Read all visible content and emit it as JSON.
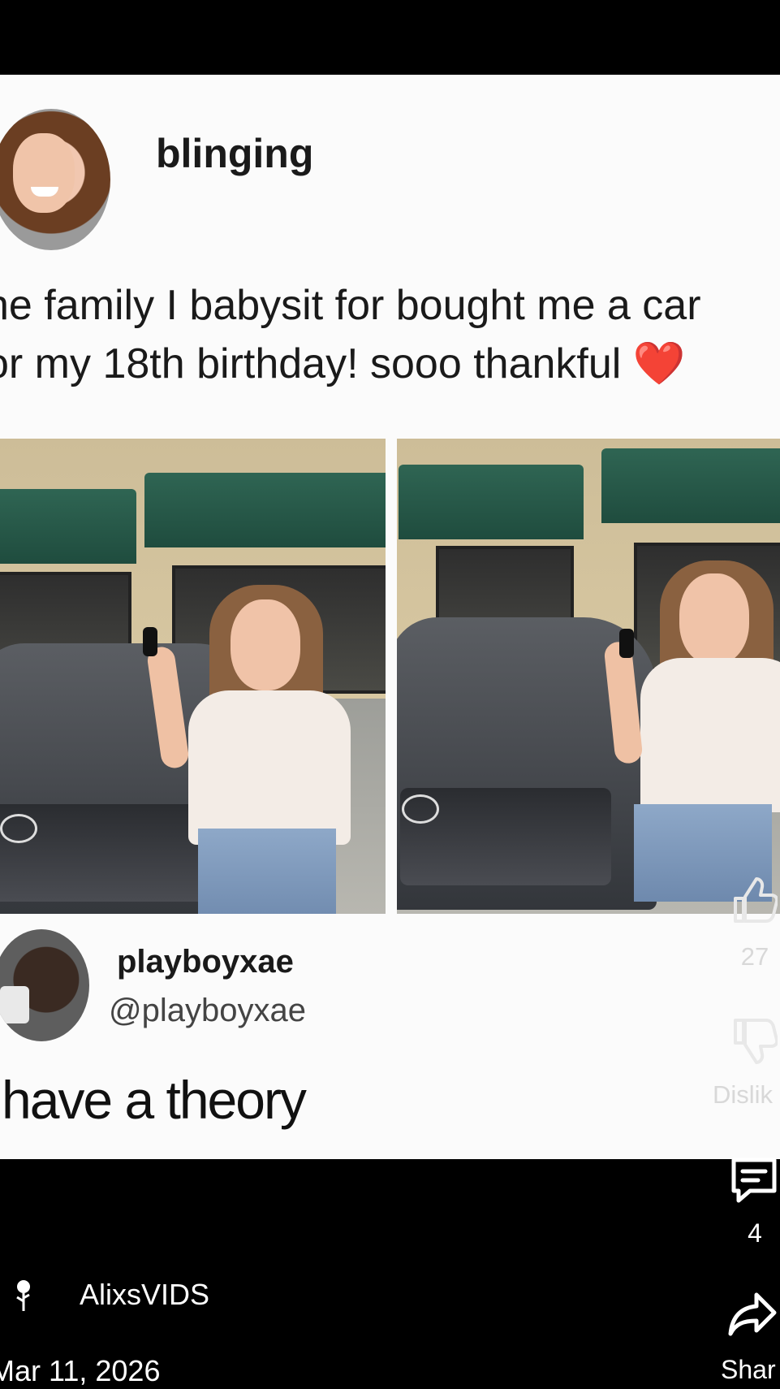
{
  "post": {
    "username": "blinging",
    "caption_line1": "he family I babysit for bought me a car",
    "caption_line2": "or my 18th birthday! sooo thankful ",
    "heart_emoji": "❤️"
  },
  "reply": {
    "display_name": "playboyxae",
    "handle": "@playboyxae",
    "text": "have a theory"
  },
  "actions": {
    "like_count": "27",
    "dislike_label": "Dislik",
    "comments_count": "4",
    "share_label": "Shar"
  },
  "channel": {
    "name": "AlixsVIDS",
    "date": "Mar 11, 2026"
  },
  "icons": [
    "like-icon",
    "dislike-icon",
    "comments-icon",
    "share-icon",
    "rose-icon"
  ],
  "colors": {
    "background": "#000000",
    "card": "#fbfbfb",
    "heart": "#d7192a",
    "awning": "#2f6553"
  }
}
